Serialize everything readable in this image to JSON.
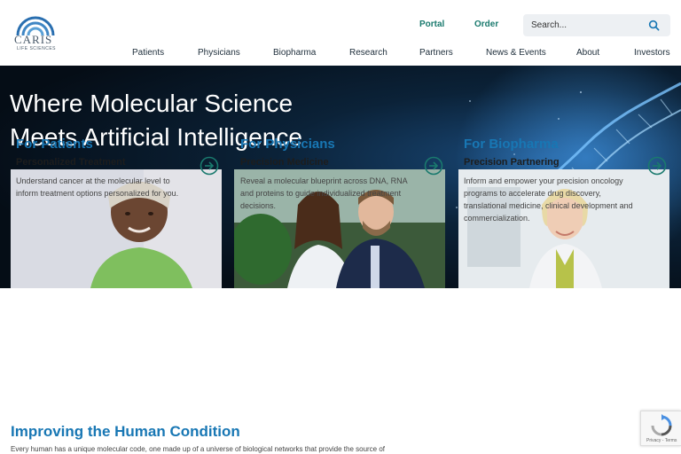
{
  "brand": {
    "name": "CARIS",
    "tagline": "LIFE SCIENCES"
  },
  "utility": {
    "portal": "Portal",
    "order": "Order"
  },
  "search": {
    "placeholder": "Search..."
  },
  "nav": [
    "Patients",
    "Physicians",
    "Biopharma",
    "Research",
    "Partners",
    "News & Events",
    "About",
    "Investors"
  ],
  "hero": {
    "line1": "Where Molecular Science",
    "line2": "Meets Artificial Intelligence"
  },
  "cards": [
    {
      "title": "For Patients",
      "subtitle": "Personalized Treatment",
      "description": "Understand cancer at the molecular level to inform treatment options personalized for you."
    },
    {
      "title": "For Physicians",
      "subtitle": "Precision Medicine",
      "description": "Reveal a molecular blueprint across DNA, RNA and proteins to guide individualized treatment decisions."
    },
    {
      "title": "For Biopharma",
      "subtitle": "Precision Partnering",
      "description": "Inform and empower your precision oncology programs to accelerate drug discovery, translational medicine, clinical development and commercialization."
    }
  ],
  "section": {
    "title": "Improving the Human Condition",
    "text": "Every human has a unique molecular code, one made up of a universe of biological networks that provide the source of"
  },
  "recaptcha": {
    "label": "Privacy - Terms"
  },
  "colors": {
    "accent": "#1877b4",
    "teal": "#1a7a6e",
    "hero_bg": "#050d16"
  }
}
